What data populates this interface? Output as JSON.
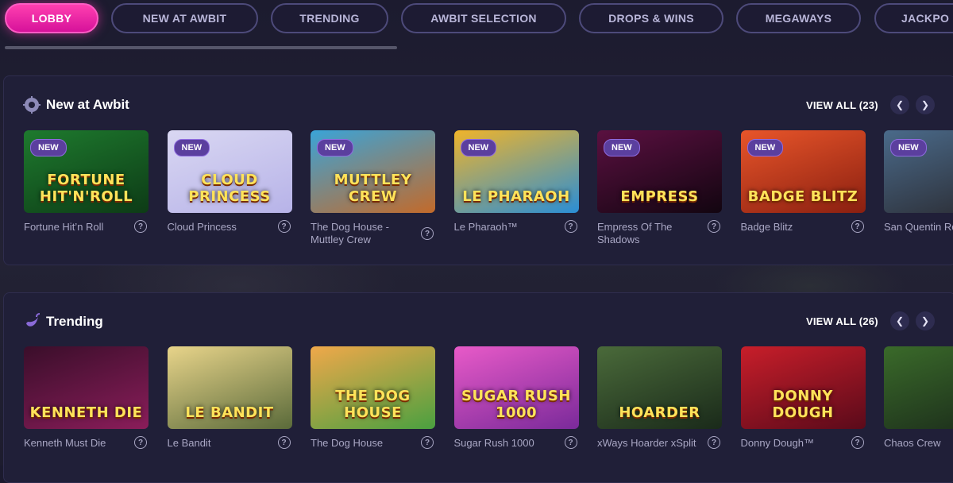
{
  "tabs": [
    {
      "label": "LOBBY",
      "active": true
    },
    {
      "label": "NEW AT AWBIT",
      "active": false
    },
    {
      "label": "TRENDING",
      "active": false
    },
    {
      "label": "AWBIT SELECTION",
      "active": false
    },
    {
      "label": "DROPS & WINS",
      "active": false
    },
    {
      "label": "MEGAWAYS",
      "active": false
    },
    {
      "label": "JACKPO",
      "active": false
    }
  ],
  "sections": {
    "new": {
      "title": "New at Awbit",
      "icon": "gear-badge-icon",
      "view_all": "VIEW ALL (23)",
      "badge_label": "NEW",
      "games": [
        {
          "name": "Fortune Hit’n Roll",
          "logo": "FORTUNE HIT'N'ROLL",
          "colors": [
            "#1e7a2e",
            "#0d3b16"
          ]
        },
        {
          "name": "Cloud Princess",
          "logo": "CLOUD PRINCESS",
          "colors": [
            "#d9d7f2",
            "#b7b3e8"
          ]
        },
        {
          "name": "The Dog House - Muttley Crew",
          "logo": "MUTTLEY CREW",
          "colors": [
            "#3aa4d8",
            "#c36a2a"
          ]
        },
        {
          "name": "Le Pharaoh™",
          "logo": "LE PHARAOH",
          "colors": [
            "#f0b42a",
            "#2a8ed6"
          ]
        },
        {
          "name": "Empress Of The Shadows",
          "logo": "EMPRESS",
          "colors": [
            "#5a1040",
            "#120510"
          ]
        },
        {
          "name": "Badge Blitz",
          "logo": "BADGE BLITZ",
          "colors": [
            "#e8552a",
            "#8a1f10"
          ]
        },
        {
          "name": "San Quentin Row",
          "logo": "",
          "colors": [
            "#4a6a8a",
            "#2a2a30"
          ]
        }
      ]
    },
    "trending": {
      "title": "Trending",
      "icon": "chili-icon",
      "view_all": "VIEW ALL (26)",
      "games": [
        {
          "name": "Kenneth Must Die",
          "logo": "KENNETH DIE",
          "colors": [
            "#3a0e2a",
            "#8a1d5a"
          ]
        },
        {
          "name": "Le Bandit",
          "logo": "LE BANDIT",
          "colors": [
            "#e8d48a",
            "#5a6a3a"
          ]
        },
        {
          "name": "The Dog House",
          "logo": "THE DOG HOUSE",
          "colors": [
            "#f0a84a",
            "#4aa040"
          ]
        },
        {
          "name": "Sugar Rush 1000",
          "logo": "SUGAR RUSH 1000",
          "colors": [
            "#e85ac8",
            "#7a2a9a"
          ]
        },
        {
          "name": "xWays Hoarder xSplit",
          "logo": "HOARDER",
          "colors": [
            "#4a6a3a",
            "#1a2a1a"
          ]
        },
        {
          "name": "Donny Dough™",
          "logo": "DONNY DOUGH",
          "colors": [
            "#c81e2a",
            "#5a0a1a"
          ]
        },
        {
          "name": "Chaos Crew",
          "logo": "",
          "colors": [
            "#3a6a2a",
            "#1a2a1a"
          ]
        }
      ]
    }
  }
}
